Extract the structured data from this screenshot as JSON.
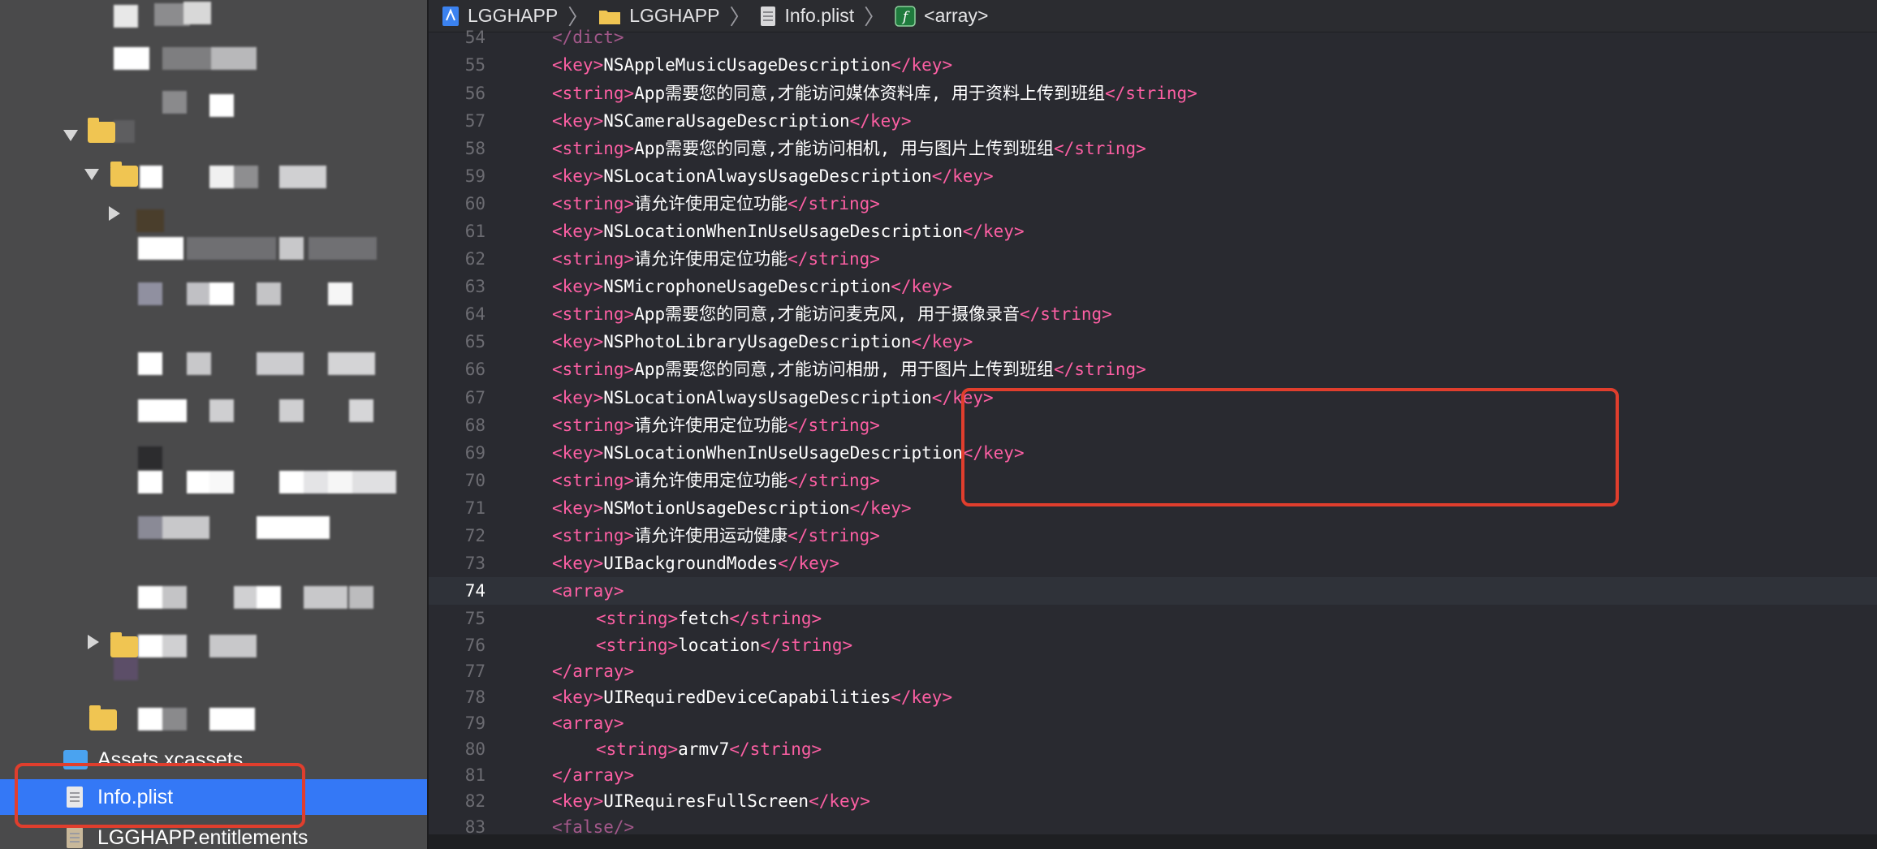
{
  "breadcrumb": {
    "items": [
      "LGGHAPP",
      "LGGHAPP",
      "Info.plist",
      "<array>"
    ]
  },
  "sidebar": {
    "items": [
      {
        "label": "Assets.xcassets"
      },
      {
        "label": "Info.plist"
      },
      {
        "label": "LGGHAPP.entitlements"
      }
    ]
  },
  "code": {
    "lines": [
      {
        "num": "54",
        "indent": 0,
        "parts": [
          [
            "tag-d",
            "</dict>"
          ]
        ]
      },
      {
        "num": "55",
        "indent": 0,
        "parts": [
          [
            "tag",
            "<key>"
          ],
          [
            "txt",
            "NSAppleMusicUsageDescription"
          ],
          [
            "tag",
            "</key>"
          ]
        ]
      },
      {
        "num": "56",
        "indent": 0,
        "parts": [
          [
            "tag",
            "<string>"
          ],
          [
            "txt",
            "App需要您的同意,才能访问媒体资料库, 用于资料上传到班组"
          ],
          [
            "tag",
            "</string>"
          ]
        ]
      },
      {
        "num": "57",
        "indent": 0,
        "parts": [
          [
            "tag",
            "<key>"
          ],
          [
            "txt",
            "NSCameraUsageDescription"
          ],
          [
            "tag",
            "</key>"
          ]
        ]
      },
      {
        "num": "58",
        "indent": 0,
        "parts": [
          [
            "tag",
            "<string>"
          ],
          [
            "txt",
            "App需要您的同意,才能访问相机, 用与图片上传到班组"
          ],
          [
            "tag",
            "</string>"
          ]
        ]
      },
      {
        "num": "59",
        "indent": 0,
        "parts": [
          [
            "tag",
            "<key>"
          ],
          [
            "txt",
            "NSLocationAlwaysUsageDescription"
          ],
          [
            "tag",
            "</key>"
          ]
        ]
      },
      {
        "num": "60",
        "indent": 0,
        "parts": [
          [
            "tag",
            "<string>"
          ],
          [
            "txt",
            "请允许使用定位功能"
          ],
          [
            "tag",
            "</string>"
          ]
        ]
      },
      {
        "num": "61",
        "indent": 0,
        "parts": [
          [
            "tag",
            "<key>"
          ],
          [
            "txt",
            "NSLocationWhenInUseUsageDescription"
          ],
          [
            "tag",
            "</key>"
          ]
        ]
      },
      {
        "num": "62",
        "indent": 0,
        "parts": [
          [
            "tag",
            "<string>"
          ],
          [
            "txt",
            "请允许使用定位功能"
          ],
          [
            "tag",
            "</string>"
          ]
        ]
      },
      {
        "num": "63",
        "indent": 0,
        "parts": [
          [
            "tag",
            "<key>"
          ],
          [
            "txt",
            "NSMicrophoneUsageDescription"
          ],
          [
            "tag",
            "</key>"
          ]
        ]
      },
      {
        "num": "64",
        "indent": 0,
        "parts": [
          [
            "tag",
            "<string>"
          ],
          [
            "txt",
            "App需要您的同意,才能访问麦克风, 用于摄像录音"
          ],
          [
            "tag",
            "</string>"
          ]
        ]
      },
      {
        "num": "65",
        "indent": 0,
        "parts": [
          [
            "tag",
            "<key>"
          ],
          [
            "txt",
            "NSPhotoLibraryUsageDescription"
          ],
          [
            "tag",
            "</key>"
          ]
        ]
      },
      {
        "num": "66",
        "indent": 0,
        "parts": [
          [
            "tag",
            "<string>"
          ],
          [
            "txt",
            "App需要您的同意,才能访问相册, 用于图片上传到班组"
          ],
          [
            "tag",
            "</string>"
          ]
        ]
      },
      {
        "num": "67",
        "indent": 0,
        "parts": [
          [
            "tag",
            "<key>"
          ],
          [
            "txt",
            "NSLocationAlwaysUsageDescription"
          ],
          [
            "tag",
            "</key>"
          ]
        ]
      },
      {
        "num": "68",
        "indent": 0,
        "parts": [
          [
            "tag",
            "<string>"
          ],
          [
            "txt",
            "请允许使用定位功能"
          ],
          [
            "tag",
            "</string>"
          ]
        ]
      },
      {
        "num": "69",
        "indent": 0,
        "parts": [
          [
            "tag",
            "<key>"
          ],
          [
            "txt",
            "NSLocationWhenInUseUsageDescription"
          ],
          [
            "tag",
            "</key>"
          ]
        ]
      },
      {
        "num": "70",
        "indent": 0,
        "parts": [
          [
            "tag",
            "<string>"
          ],
          [
            "txt",
            "请允许使用定位功能"
          ],
          [
            "tag",
            "</string>"
          ]
        ]
      },
      {
        "num": "71",
        "indent": 0,
        "parts": [
          [
            "tag",
            "<key>"
          ],
          [
            "txt",
            "NSMotionUsageDescription"
          ],
          [
            "tag",
            "</key>"
          ]
        ]
      },
      {
        "num": "72",
        "indent": 0,
        "parts": [
          [
            "tag",
            "<string>"
          ],
          [
            "txt",
            "请允许使用运动健康"
          ],
          [
            "tag",
            "</string>"
          ]
        ]
      },
      {
        "num": "73",
        "indent": 0,
        "parts": [
          [
            "tag",
            "<key>"
          ],
          [
            "txt",
            "UIBackgroundModes"
          ],
          [
            "tag",
            "</key>"
          ]
        ]
      },
      {
        "num": "74",
        "indent": 0,
        "current": true,
        "parts": [
          [
            "tag",
            "<array>"
          ]
        ]
      },
      {
        "num": "75",
        "indent": 1,
        "parts": [
          [
            "tag",
            "<string>"
          ],
          [
            "txt",
            "fetch"
          ],
          [
            "tag",
            "</string>"
          ]
        ]
      },
      {
        "num": "76",
        "indent": 1,
        "parts": [
          [
            "tag",
            "<string>"
          ],
          [
            "txt",
            "location"
          ],
          [
            "tag",
            "</string>"
          ]
        ]
      },
      {
        "num": "77",
        "indent": 0,
        "parts": [
          [
            "tag",
            "</array>"
          ]
        ]
      },
      {
        "num": "78",
        "indent": 0,
        "parts": [
          [
            "tag",
            "<key>"
          ],
          [
            "txt",
            "UIRequiredDeviceCapabilities"
          ],
          [
            "tag",
            "</key>"
          ]
        ]
      },
      {
        "num": "79",
        "indent": 0,
        "parts": [
          [
            "tag",
            "<array>"
          ]
        ]
      },
      {
        "num": "80",
        "indent": 1,
        "parts": [
          [
            "tag",
            "<string>"
          ],
          [
            "txt",
            "armv7"
          ],
          [
            "tag",
            "</string>"
          ]
        ]
      },
      {
        "num": "81",
        "indent": 0,
        "parts": [
          [
            "tag",
            "</array>"
          ]
        ]
      },
      {
        "num": "82",
        "indent": 0,
        "parts": [
          [
            "tag",
            "<key>"
          ],
          [
            "txt",
            "UIRequiresFullScreen"
          ],
          [
            "tag",
            "</key>"
          ]
        ]
      },
      {
        "num": "83",
        "indent": 0,
        "parts": [
          [
            "tag-d",
            "<false/>"
          ]
        ]
      }
    ]
  }
}
